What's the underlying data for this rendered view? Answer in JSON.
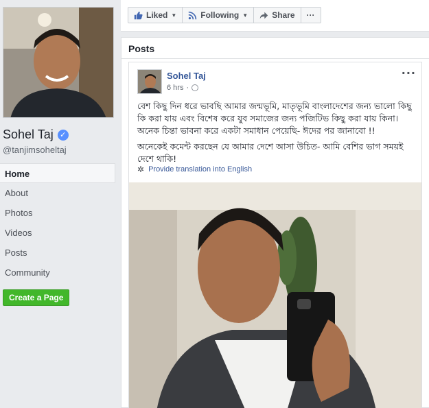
{
  "profile": {
    "name": "Sohel Taj",
    "handle": "@tanjimsoheltaj",
    "verified_icon": "check-badge-icon"
  },
  "nav": {
    "items": [
      {
        "label": "Home",
        "active": true
      },
      {
        "label": "About"
      },
      {
        "label": "Photos"
      },
      {
        "label": "Videos"
      },
      {
        "label": "Posts"
      },
      {
        "label": "Community"
      }
    ],
    "create_page_label": "Create a Page"
  },
  "actionbar": {
    "liked_label": "Liked",
    "following_label": "Following",
    "share_label": "Share",
    "more_label": "···"
  },
  "posts": {
    "section_title": "Posts",
    "post": {
      "author": "Sohel Taj",
      "time": "6 hrs",
      "more_label": "···",
      "paragraph1": "বেশ কিছু দিন ধরে ভাবছি আমার জন্মভূমি, মাতৃভূমি বাংলাদেশের জন্য ভালো কিছু কি করা যায় এবং বিশেষ করে যুব সমাজের জন্য পজিটিভ কিছু করা যায় কিনা। অনেক চিন্তা ভাবনা করে একটা সমাধান পেয়েছি- ঈদের পর জানাবো !!",
      "paragraph2": "অনেকেই কমেন্ট করছেন যে আমার দেশে আসা উচিত- আমি বেশির ভাগ সময়ই দেশে থাকি!",
      "translate_label": "Provide translation into English"
    }
  },
  "colors": {
    "link": "#365899",
    "create_button": "#42b72a",
    "verified": "#5890ff"
  }
}
